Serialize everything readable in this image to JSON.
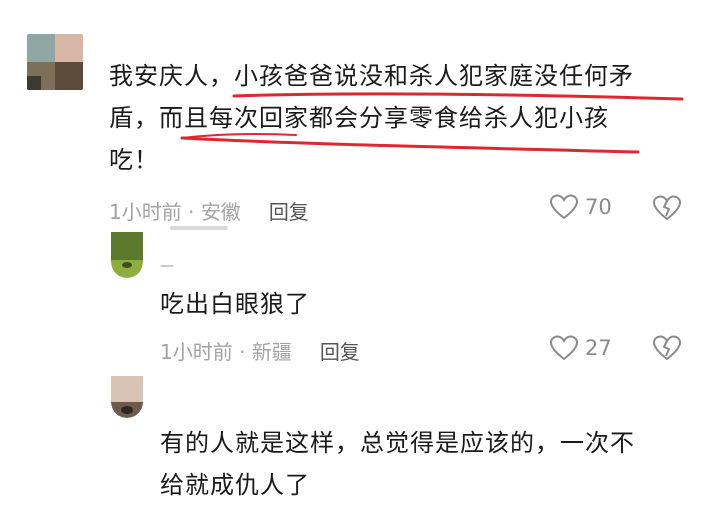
{
  "comments": [
    {
      "lines": [
        "我安庆人，小孩爸爸说没和杀人犯家庭没任何矛",
        "盾，而且每次回家都会分享零食给杀人犯小孩",
        "吃！"
      ],
      "time": "1小时前",
      "location": "安徽",
      "reply_label": "回复",
      "likes": "70"
    },
    {
      "name": "—",
      "text": "吃出白眼狼了",
      "time": "1小时前",
      "location": "新疆",
      "reply_label": "回复",
      "likes": "27"
    },
    {
      "text": "有的人就是这样，总觉得是应该的，一次不",
      "text2": "给就成仇人了"
    }
  ],
  "meta_separator": " · ",
  "colors": {
    "highlight_underline": "#e0272f",
    "meta_gray": "#a3a3a3",
    "reply_dark": "#555555",
    "icon_gray": "#8a8a8a"
  },
  "icons": {
    "like": "heart-outline-icon",
    "dislike": "broken-heart-icon"
  }
}
